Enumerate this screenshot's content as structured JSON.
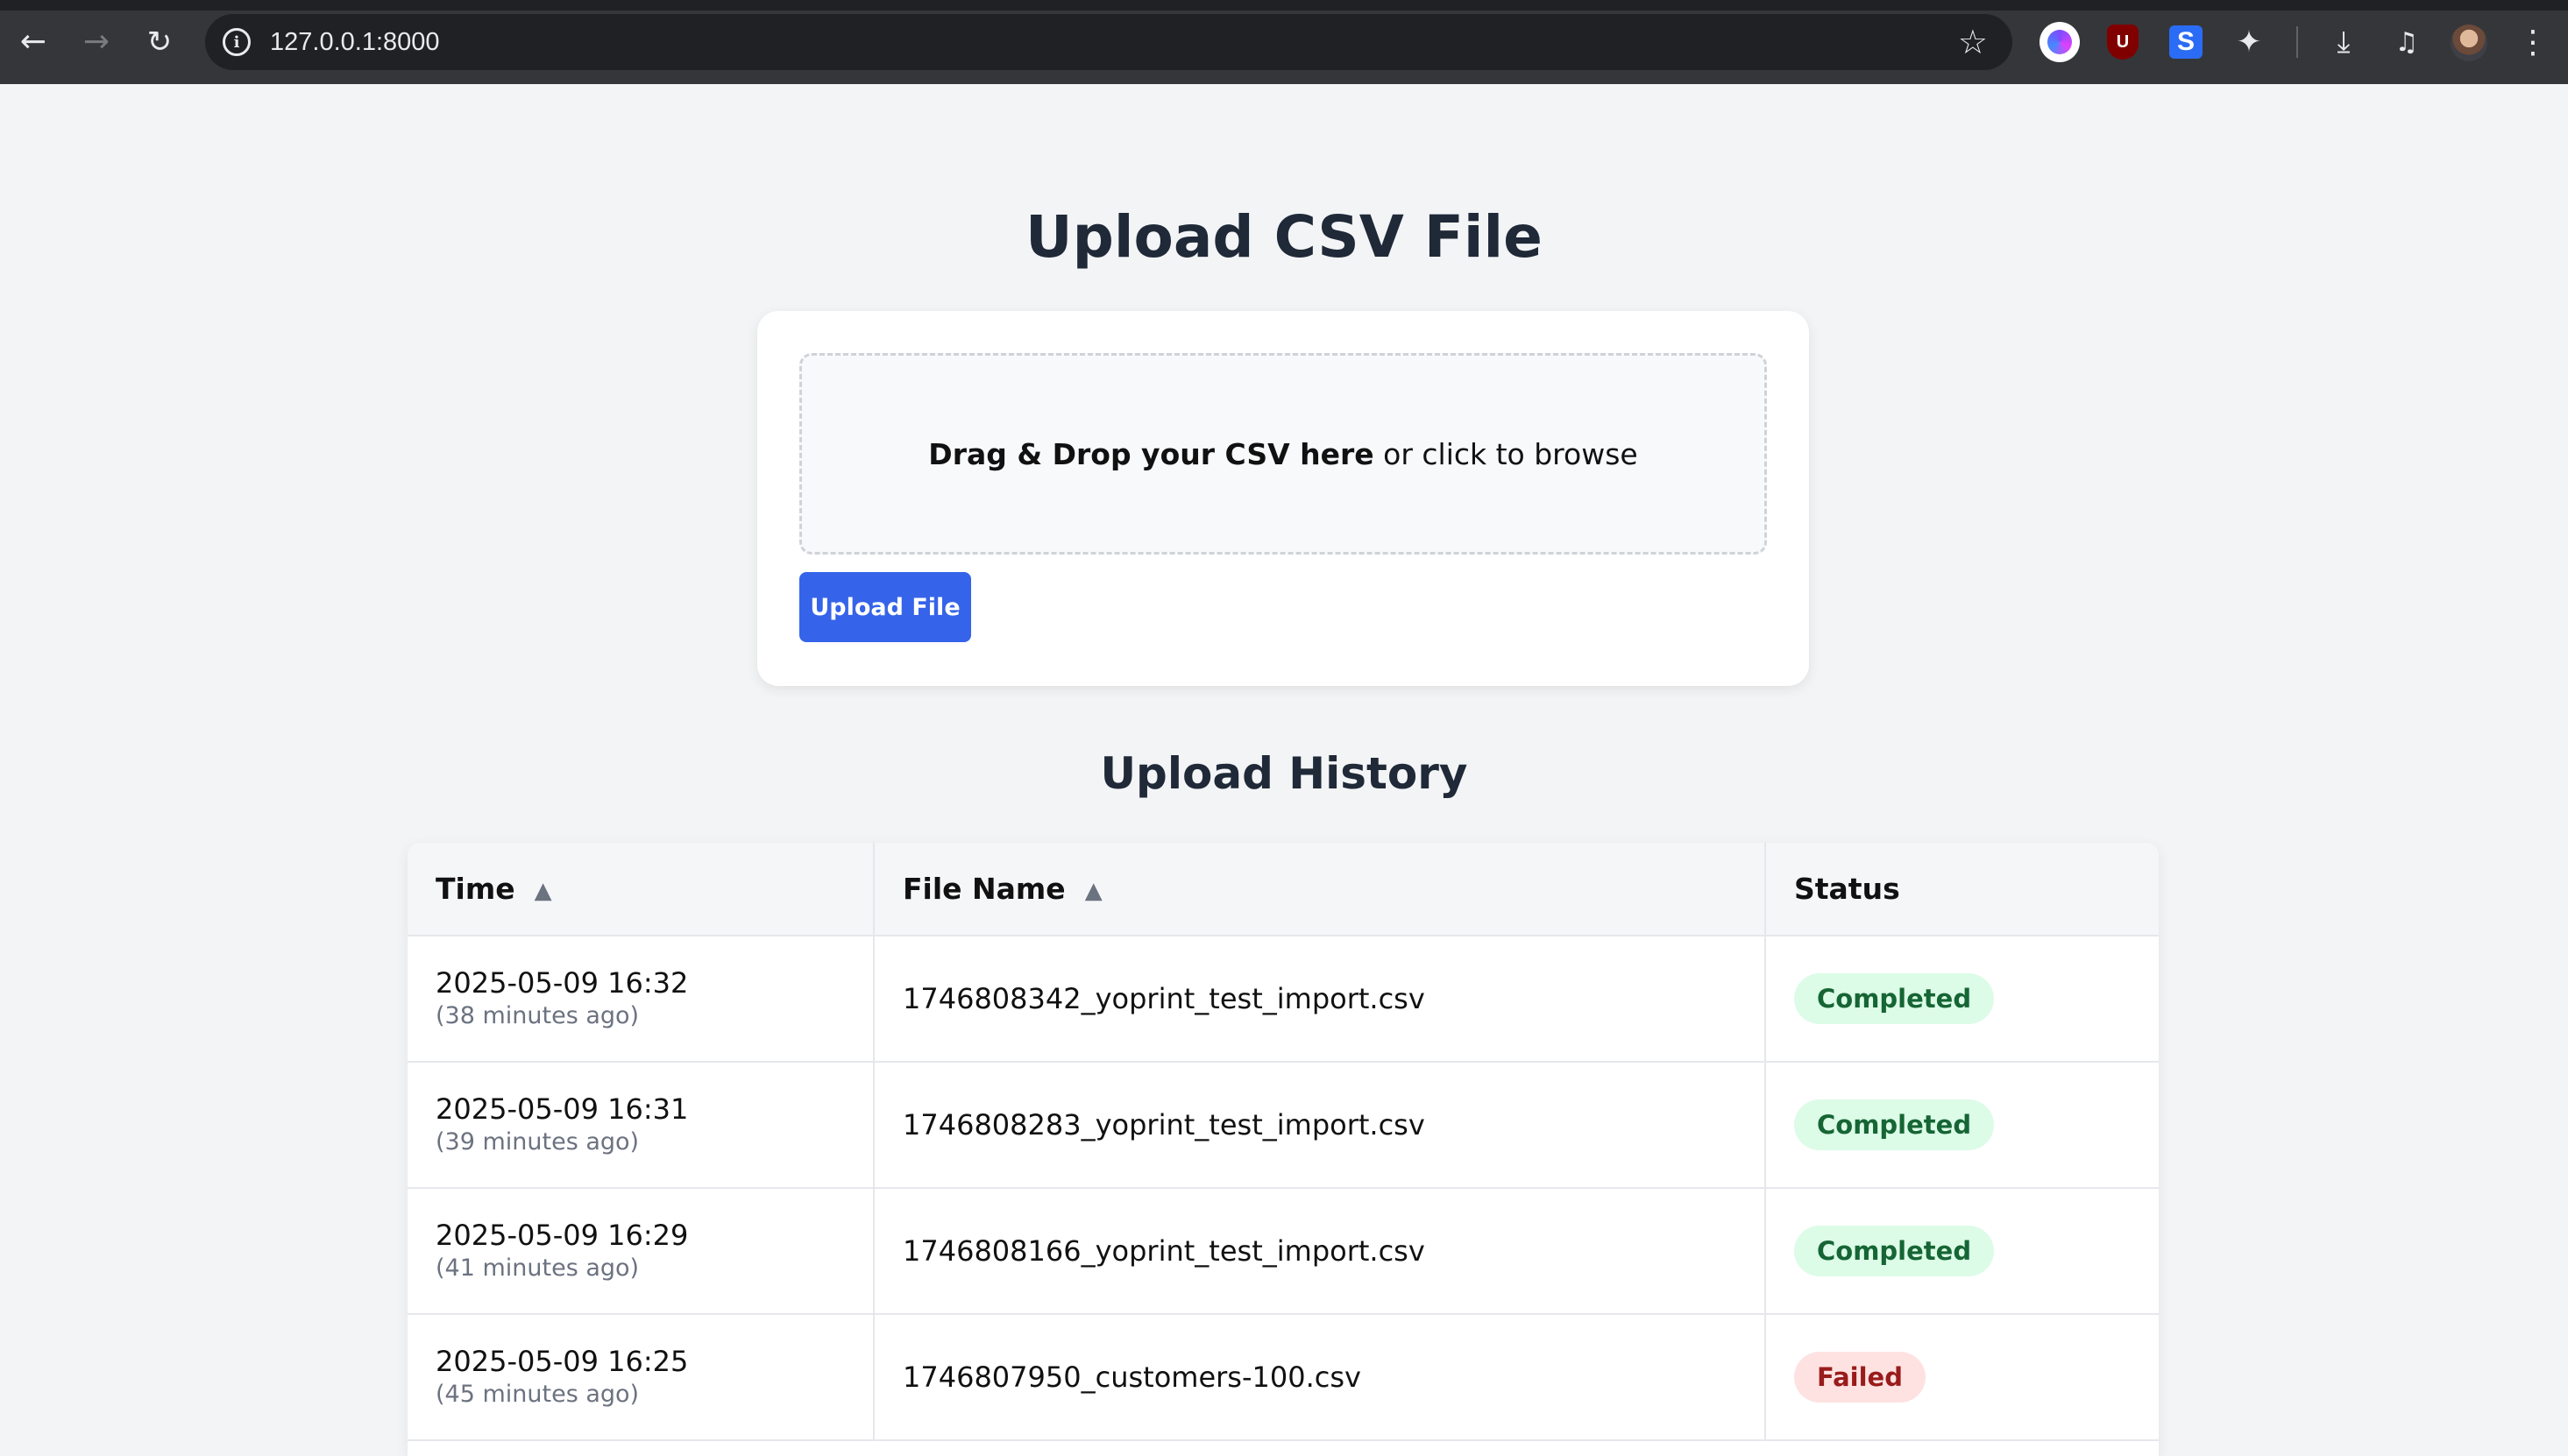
{
  "browser": {
    "url": "127.0.0.1:8000",
    "icons": {
      "back": "back-arrow-icon",
      "forward": "forward-arrow-icon",
      "reload": "reload-icon",
      "info": "info-icon",
      "star": "star-icon",
      "extensions": [
        "ai-extension-icon",
        "ublock-icon",
        "s-extension-icon",
        "puzzle-icon"
      ],
      "download": "download-icon",
      "media": "media-controls-icon",
      "menu": "kebab-menu-icon"
    }
  },
  "upload": {
    "title": "Upload CSV File",
    "dropzone_bold": "Drag & Drop your CSV here",
    "dropzone_rest": " or click to browse",
    "button_label": "Upload File"
  },
  "history": {
    "title": "Upload History",
    "columns": [
      "Time",
      "File Name",
      "Status"
    ],
    "rows": [
      {
        "time": "2025-05-09 16:32",
        "relative": "(38 minutes ago)",
        "file": "1746808342_yoprint_test_import.csv",
        "status": "Completed"
      },
      {
        "time": "2025-05-09 16:31",
        "relative": "(39 minutes ago)",
        "file": "1746808283_yoprint_test_import.csv",
        "status": "Completed"
      },
      {
        "time": "2025-05-09 16:29",
        "relative": "(41 minutes ago)",
        "file": "1746808166_yoprint_test_import.csv",
        "status": "Completed"
      },
      {
        "time": "2025-05-09 16:25",
        "relative": "(45 minutes ago)",
        "file": "1746807950_customers-100.csv",
        "status": "Failed"
      }
    ]
  },
  "colors": {
    "primary_button": "#3563e9",
    "completed_bg": "#dcfce7",
    "completed_text": "#166534",
    "failed_bg": "#fee2e2",
    "failed_text": "#991b1b"
  }
}
